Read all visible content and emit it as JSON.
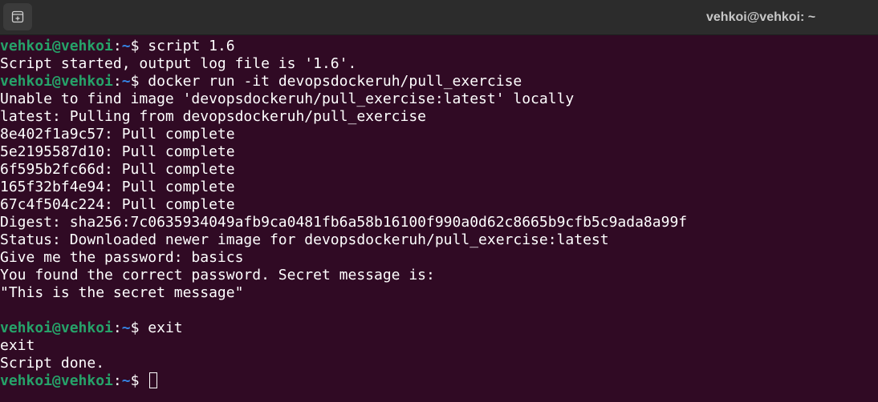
{
  "window": {
    "title": "vehkoi@vehkoi: ~"
  },
  "icons": {
    "new_tab": "new-tab-icon"
  },
  "colors": {
    "background": "#300a24",
    "prompt_user": "#26a269",
    "prompt_path": "#3584e4",
    "text": "#ffffff"
  },
  "terminal": {
    "prompt": {
      "user": "vehkoi@vehkoi",
      "colon": ":",
      "path": "~",
      "symbol": "$ "
    },
    "lines": [
      {
        "type": "command",
        "text": "script 1.6"
      },
      {
        "type": "output",
        "text": "Script started, output log file is '1.6'."
      },
      {
        "type": "command",
        "text": "docker run -it devopsdockeruh/pull_exercise"
      },
      {
        "type": "output",
        "text": "Unable to find image 'devopsdockeruh/pull_exercise:latest' locally"
      },
      {
        "type": "output",
        "text": "latest: Pulling from devopsdockeruh/pull_exercise"
      },
      {
        "type": "output",
        "text": "8e402f1a9c57: Pull complete"
      },
      {
        "type": "output",
        "text": "5e2195587d10: Pull complete"
      },
      {
        "type": "output",
        "text": "6f595b2fc66d: Pull complete"
      },
      {
        "type": "output",
        "text": "165f32bf4e94: Pull complete"
      },
      {
        "type": "output",
        "text": "67c4f504c224: Pull complete"
      },
      {
        "type": "output",
        "text": "Digest: sha256:7c0635934049afb9ca0481fb6a58b16100f990a0d62c8665b9cfb5c9ada8a99f"
      },
      {
        "type": "output",
        "text": "Status: Downloaded newer image for devopsdockeruh/pull_exercise:latest"
      },
      {
        "type": "output",
        "text": "Give me the password: basics"
      },
      {
        "type": "output",
        "text": "You found the correct password. Secret message is:"
      },
      {
        "type": "output",
        "text": "\"This is the secret message\""
      },
      {
        "type": "output",
        "text": ""
      },
      {
        "type": "command",
        "text": "exit"
      },
      {
        "type": "output",
        "text": "exit"
      },
      {
        "type": "output",
        "text": "Script done."
      },
      {
        "type": "active",
        "text": ""
      }
    ]
  }
}
